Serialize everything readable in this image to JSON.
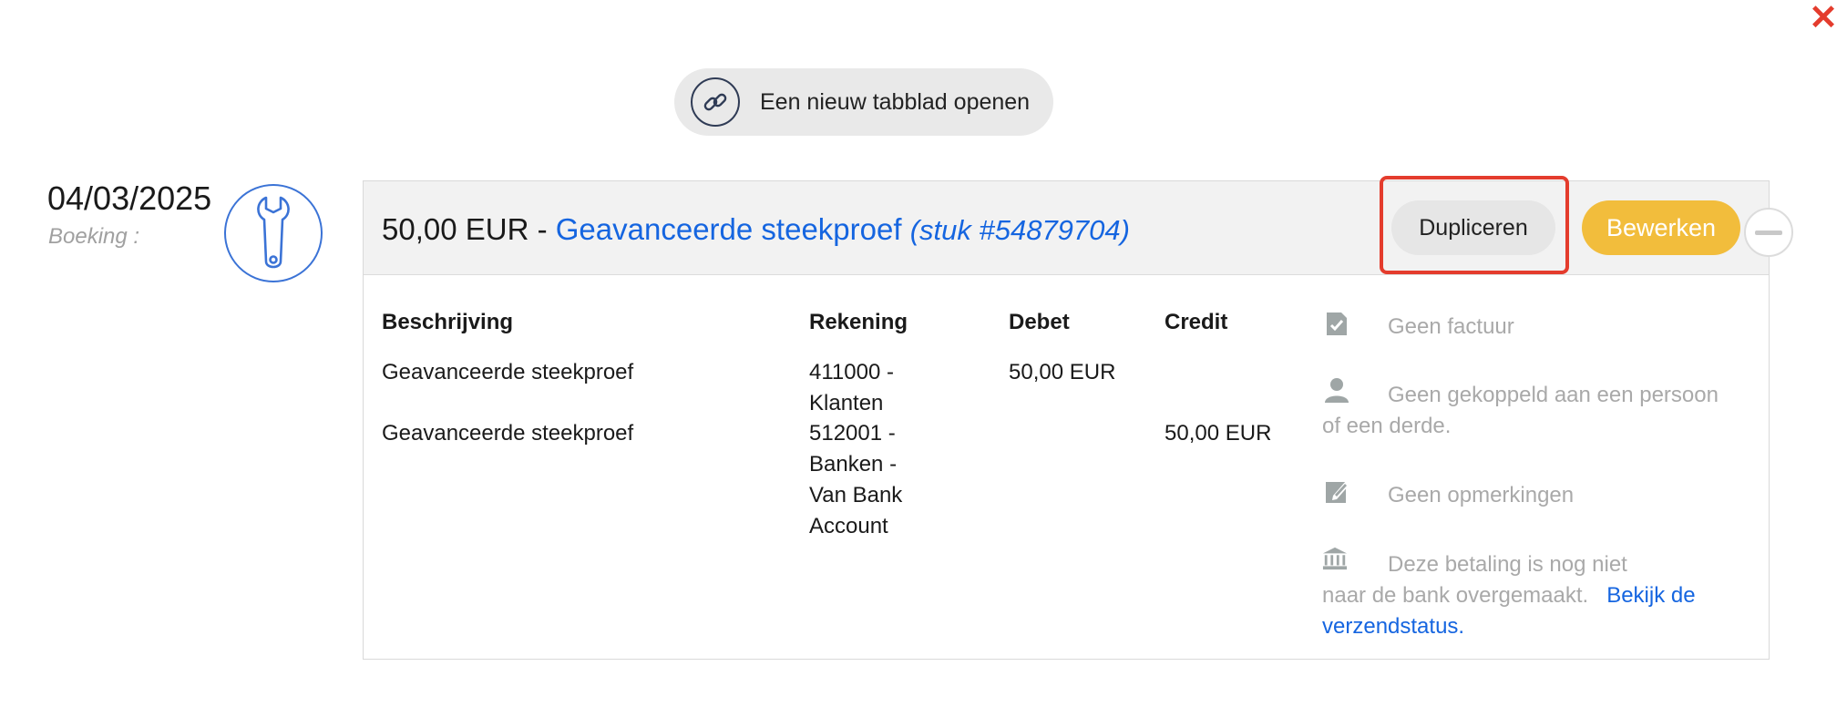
{
  "dialog": {
    "close_glyph": "✕"
  },
  "open_tab": {
    "label": "Een nieuw tabblad openen",
    "icon": "link-icon"
  },
  "entry": {
    "date": "04/03/2025",
    "type_label": "Boeking :",
    "type_icon": "wrench-icon"
  },
  "header": {
    "amount": "50,00 EUR",
    "separator": " - ",
    "journal": "Geavanceerde steekproef",
    "piece": "(stuk #54879704)"
  },
  "actions": {
    "duplicate_label": "Dupliceren",
    "edit_label": "Bewerken",
    "edit_color": "#f2bd3c",
    "highlight_color": "#e43c2d"
  },
  "table": {
    "columns": [
      "Beschrijving",
      "Rekening",
      "Debet",
      "Credit"
    ],
    "rows": [
      {
        "description": "Geavanceerde steekproef",
        "account_lines": [
          "411000 -",
          "Klanten"
        ],
        "debit": "50,00 EUR",
        "credit": ""
      },
      {
        "description": "Geavanceerde steekproef",
        "account_lines": [
          "512001 -",
          "Banken -",
          "Van Bank",
          "Account"
        ],
        "debit": "",
        "credit": "50,00 EUR"
      }
    ]
  },
  "sidebar": {
    "invoice": {
      "text": "Geen factuur",
      "icon": "invoice-check-icon"
    },
    "person": {
      "line1": "Geen gekoppeld aan een persoon",
      "line2": "of een derde.",
      "icon": "person-icon"
    },
    "notes": {
      "text": "Geen opmerkingen",
      "icon": "edit-note-icon"
    },
    "payment": {
      "line1": "Deze betaling is nog niet",
      "line2": "naar de bank overgemaakt.",
      "link_part1": "Bekijk de",
      "link_part2": "verzendstatus.",
      "icon": "bank-icon"
    }
  }
}
